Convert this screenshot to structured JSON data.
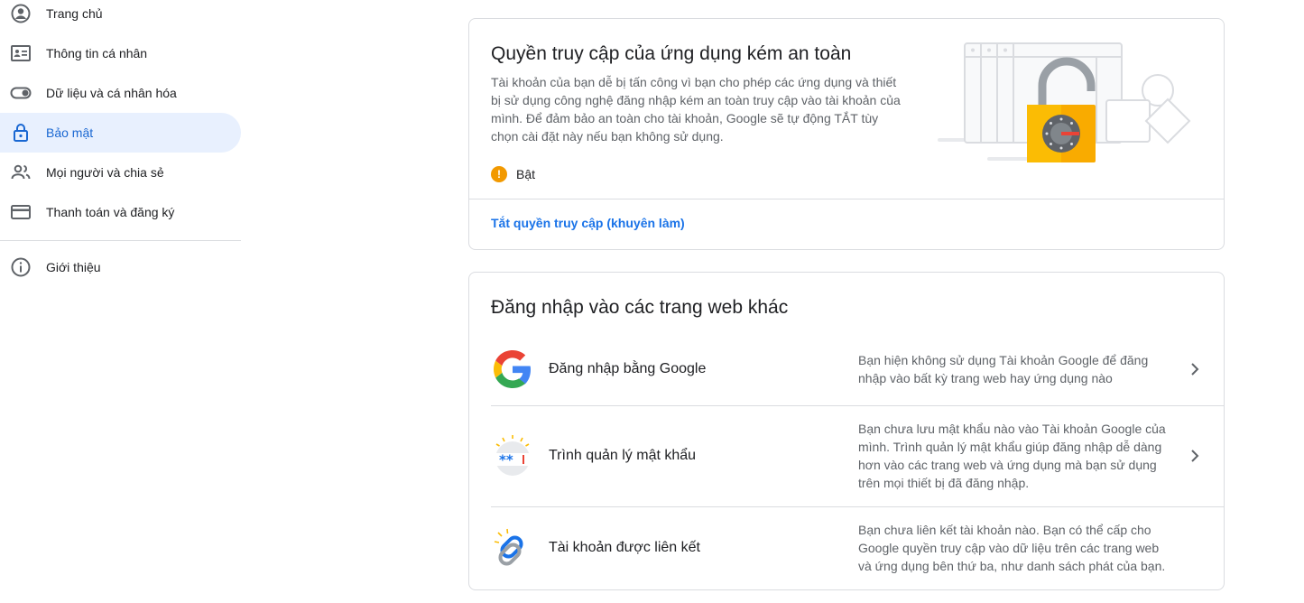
{
  "sidebar": {
    "items": [
      {
        "label": "Trang chủ",
        "icon": "account-circle-icon",
        "active": false
      },
      {
        "label": "Thông tin cá nhân",
        "icon": "id-card-icon",
        "active": false
      },
      {
        "label": "Dữ liệu và cá nhân hóa",
        "icon": "toggle-icon",
        "active": false
      },
      {
        "label": "Bảo mật",
        "icon": "lock-icon",
        "active": true
      },
      {
        "label": "Mọi người và chia sẻ",
        "icon": "people-icon",
        "active": false
      },
      {
        "label": "Thanh toán và đăng ký",
        "icon": "credit-card-icon",
        "active": false
      }
    ],
    "about": {
      "label": "Giới thiệu",
      "icon": "info-icon"
    }
  },
  "less_secure": {
    "title": "Quyền truy cập của ứng dụng kém an toàn",
    "description": "Tài khoản của bạn dễ bị tấn công vì bạn cho phép các ứng dụng và thiết bị sử dụng công nghệ đăng nhập kém an toàn truy cập vào tài khoản của mình. Để đảm bảo an toàn cho tài khoản, Google sẽ tự động TẮT tùy chọn cài đặt này nếu bạn không sử dụng.",
    "status": "Bật",
    "action_link": "Tắt quyền truy cập (khuyên làm)"
  },
  "other_sites": {
    "title": "Đăng nhập vào các trang web khác",
    "rows": [
      {
        "label": "Đăng nhập bằng Google",
        "description": "Bạn hiện không sử dụng Tài khoản Google để đăng nhập vào bất kỳ trang web hay ứng dụng nào"
      },
      {
        "label": "Trình quản lý mật khẩu",
        "description": "Bạn chưa lưu mật khẩu nào vào Tài khoản Google của mình. Trình quản lý mật khẩu giúp đăng nhập dễ dàng hơn vào các trang web và ứng dụng mà bạn sử dụng trên mọi thiết bị đã đăng nhập."
      },
      {
        "label": "Tài khoản được liên kết",
        "description": "Bạn chưa liên kết tài khoản nào. Bạn có thể cấp cho Google quyền truy cập vào dữ liệu trên các trang web và ứng dụng bên thứ ba, như danh sách phát của bạn."
      }
    ]
  },
  "colors": {
    "accent": "#1a73e8",
    "active_bg": "#e8f0fe",
    "warning": "#f29900",
    "lock_gold": "#f9ab00"
  }
}
